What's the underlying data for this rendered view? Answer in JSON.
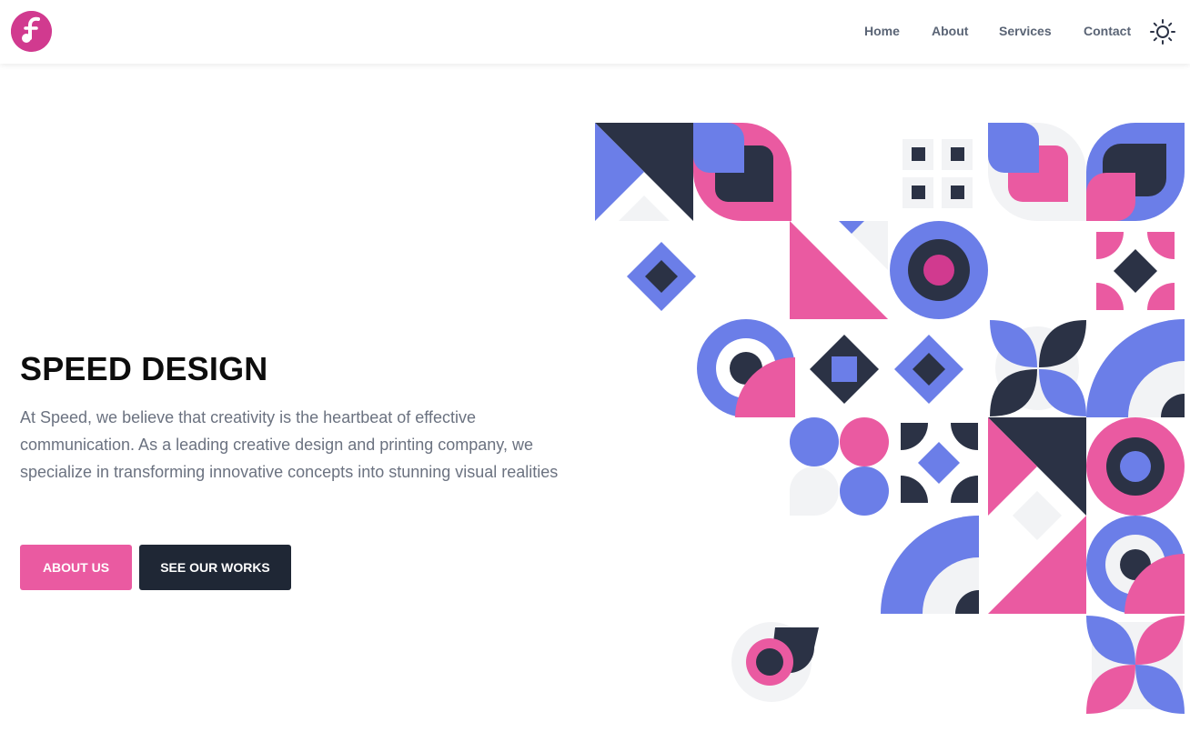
{
  "nav": {
    "logo": "logo-icon",
    "links": [
      "Home",
      "About",
      "Services",
      "Contact"
    ],
    "theme_icon": "sun-icon"
  },
  "hero": {
    "title": "SPEED DESIGN",
    "description": "At Speed, we believe that creativity is the heartbeat of effective communication. As a leading creative design and printing company, we specialize in transforming innovative concepts into stunning visual realities",
    "buttons": {
      "about": "ABOUT US",
      "works": "SEE OUR WORKS"
    }
  },
  "illustration": "geometric-pattern",
  "colors": {
    "pink": "#ea5aa1",
    "blue": "#6b7ee8",
    "dark": "#2b3245",
    "light": "#f2f3f5",
    "logo": "#d13a8f"
  }
}
